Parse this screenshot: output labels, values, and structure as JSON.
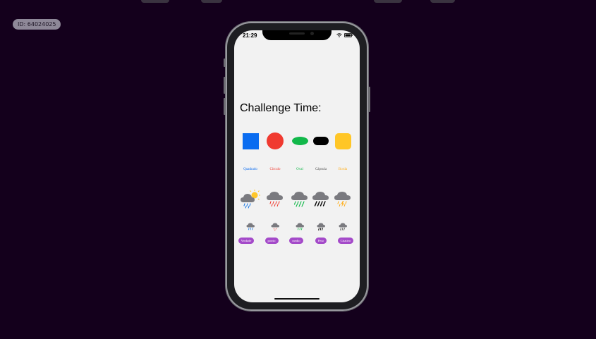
{
  "id_badge": "ID: 64024025",
  "status_bar": {
    "time": "21:29"
  },
  "title": "Challenge Time:",
  "shapes": [
    {
      "name": "square",
      "color": "#0a6cf0"
    },
    {
      "name": "circle",
      "color": "#f03a30"
    },
    {
      "name": "oval",
      "color": "#12b84a"
    },
    {
      "name": "capsule",
      "color": "#000000"
    },
    {
      "name": "rounded-square",
      "color": "#ffc627"
    }
  ],
  "labels": [
    {
      "text": "Quadrado",
      "color": "#0a6cf0"
    },
    {
      "text": "Círculo",
      "color": "#f03a30"
    },
    {
      "text": "Oval",
      "color": "#12b84a"
    },
    {
      "text": "Cápsula",
      "color": "#555555"
    },
    {
      "text": "Borda",
      "color": "#ffb020"
    }
  ],
  "weather_icons": [
    {
      "name": "cloud-sun-rain-icon",
      "rain_color": "#1e7be6"
    },
    {
      "name": "cloud-rain-icon",
      "rain_color": "#f03a30"
    },
    {
      "name": "cloud-rain-icon",
      "rain_color": "#12b84a"
    },
    {
      "name": "cloud-heavyrain-icon",
      "rain_color": "#000000"
    },
    {
      "name": "cloud-bolt-icon",
      "rain_color": "#ffb020"
    }
  ],
  "buttons": [
    {
      "label": "Verdade"
    },
    {
      "label": "porrio"
    },
    {
      "label": "medio"
    },
    {
      "label": "Peso"
    },
    {
      "label": "Criativo"
    }
  ]
}
